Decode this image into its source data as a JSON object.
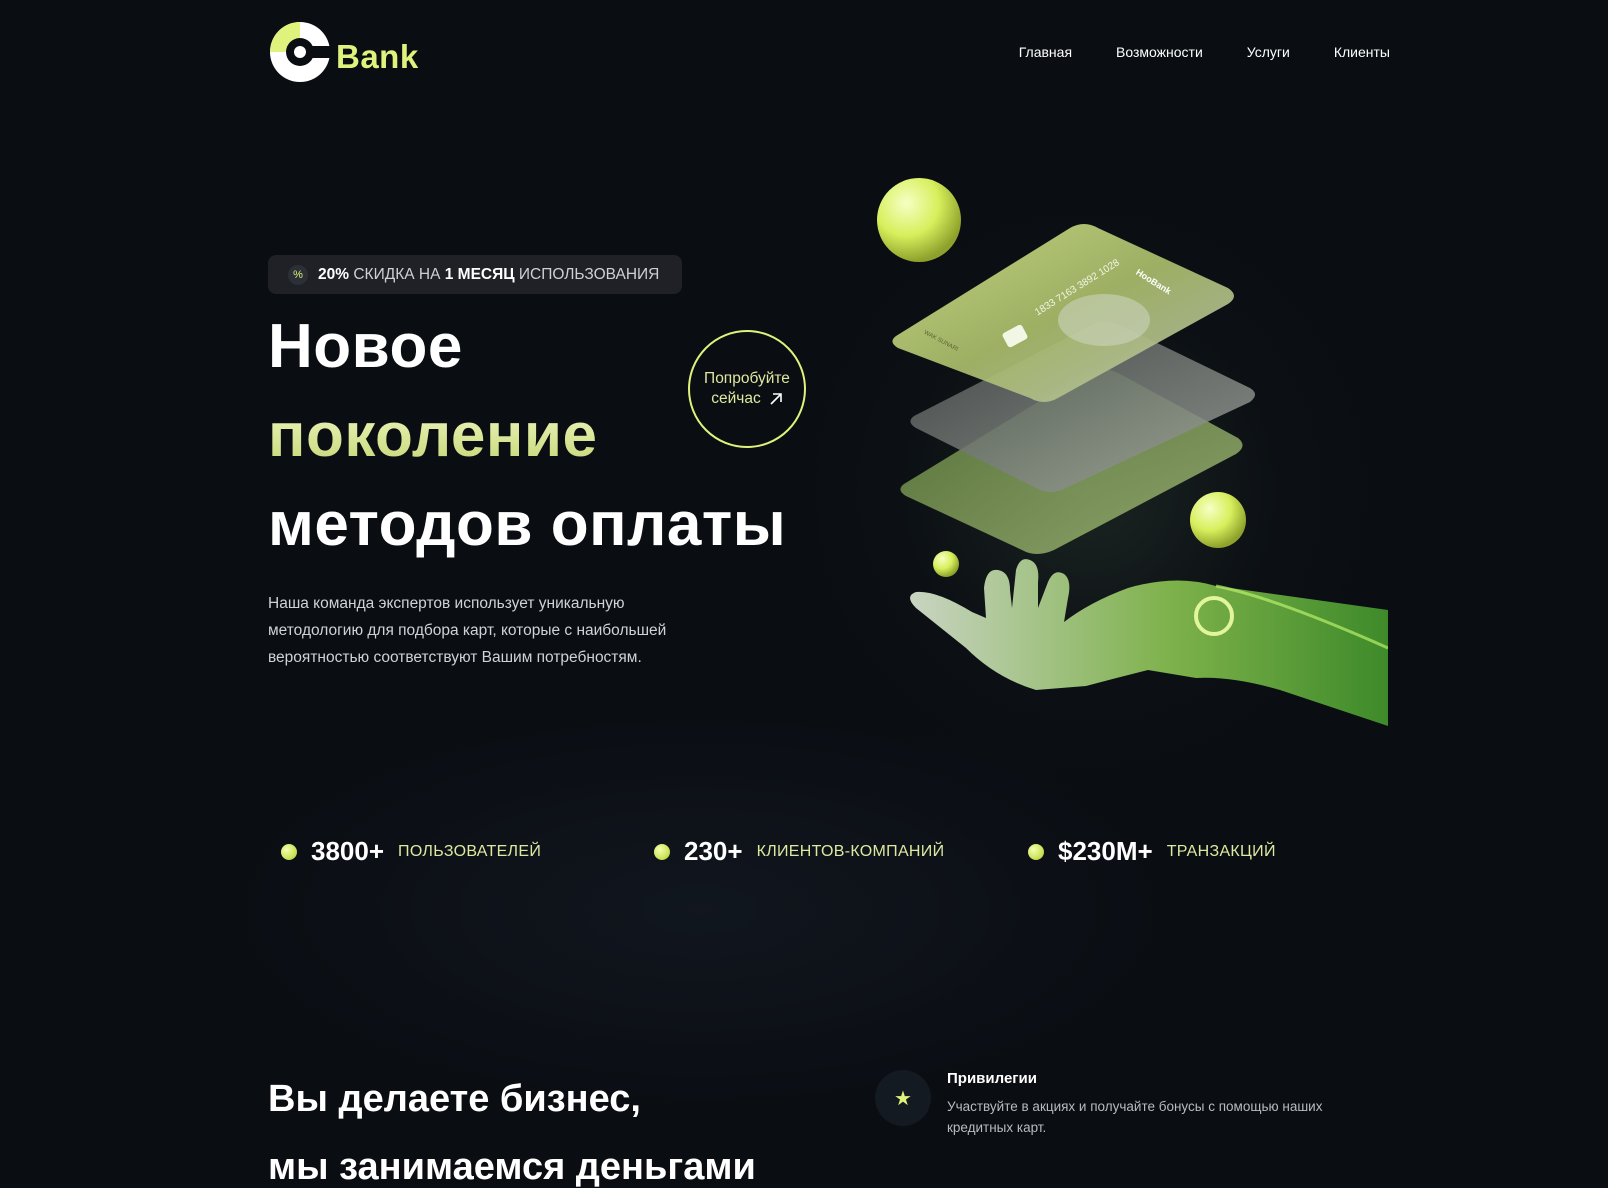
{
  "colors": {
    "background": "#0a0d12",
    "accent": "#dff27b",
    "accent_soft": "#dde8a0"
  },
  "header": {
    "logo_text": "Bank",
    "nav": [
      {
        "label": "Главная"
      },
      {
        "label": "Возможности"
      },
      {
        "label": "Услуги"
      },
      {
        "label": "Клиенты"
      }
    ]
  },
  "hero": {
    "promo": {
      "icon": "percent-icon",
      "bold_1": "20%",
      "text_1": "СКИДКА НА",
      "bold_2": "1 МЕСЯЦ",
      "text_2": "ИСПОЛЬЗОВАНИЯ"
    },
    "title_line_1": "Новое",
    "title_line_2": "поколение",
    "title_line_3": "методов оплаты",
    "description": "Наша команда экспертов использует уникальную методологию для подбора карт, которые с наибольшей вероятностью соответствуют Вашим потребностям.",
    "cta_line_1": "Попробуйте",
    "cta_line_2": "сейчас",
    "card_number": "1833 7163 3892 1028",
    "card_brand": "HooBank",
    "card_holder": "WAK SUNARI"
  },
  "stats": [
    {
      "value": "3800+",
      "label": "ПОЛЬЗОВАТЕЛЕЙ"
    },
    {
      "value": "230+",
      "label": "КЛИЕНТОВ-КОМПАНИЙ"
    },
    {
      "value": "$230M+",
      "label": "ТРАНЗАКЦИЙ"
    }
  ],
  "business": {
    "title_line_1": "Вы делаете бизнес,",
    "title_line_2": "мы занимаемся деньгами",
    "features": [
      {
        "icon": "star-icon",
        "title": "Привилегии",
        "description": "Участвуйте в акциях и получайте бонусы с помощью наших кредитных карт."
      }
    ]
  }
}
